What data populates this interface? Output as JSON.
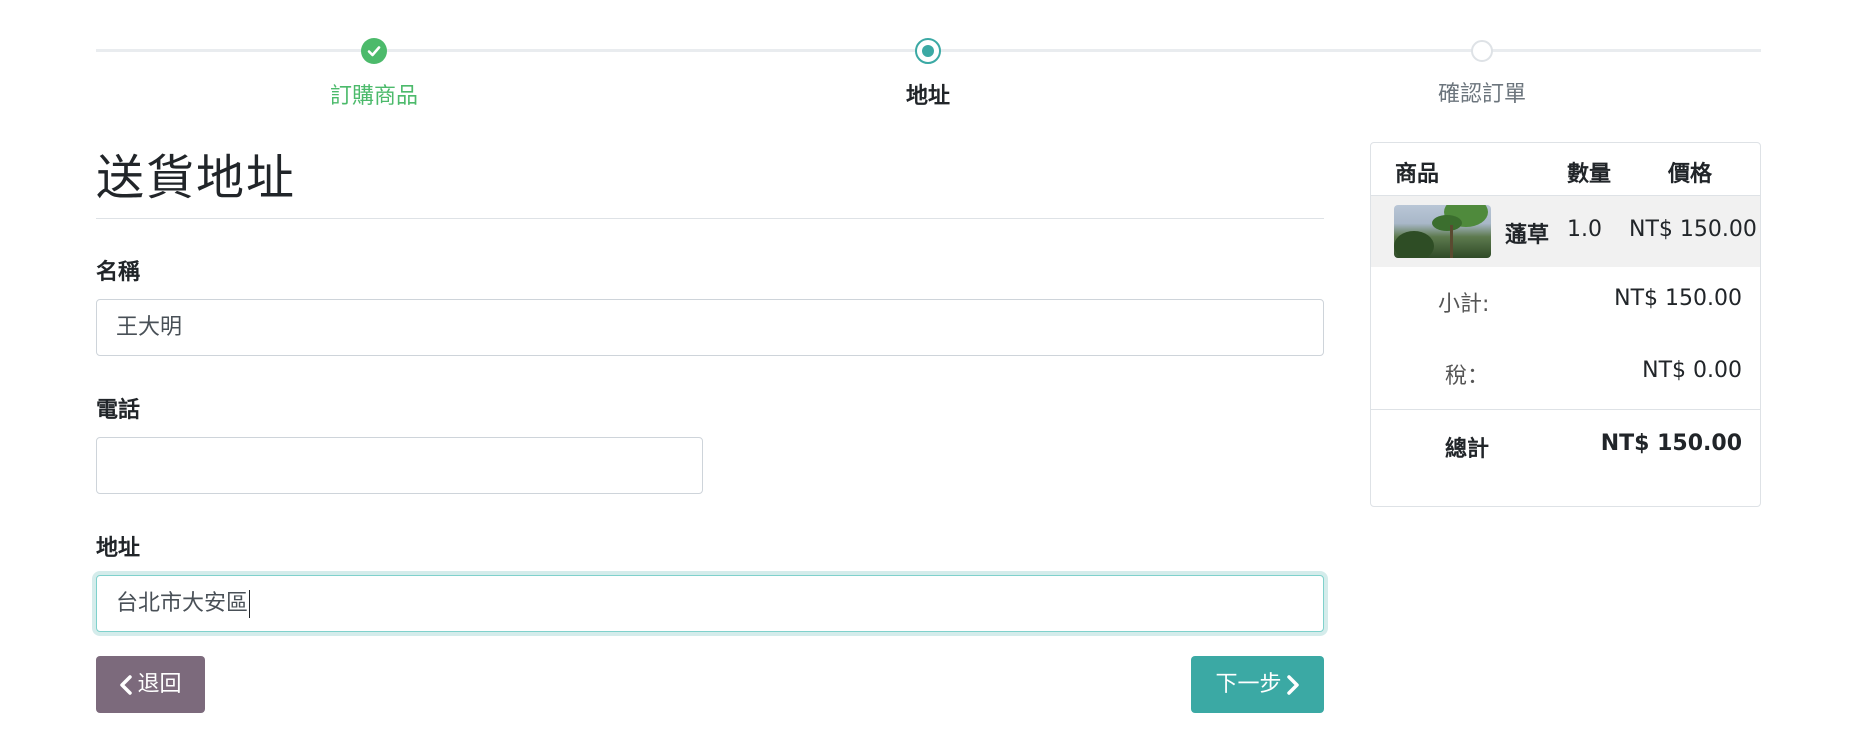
{
  "wizard": {
    "steps": [
      {
        "label": "訂購商品",
        "state": "done"
      },
      {
        "label": "地址",
        "state": "active"
      },
      {
        "label": "確認訂單",
        "state": "todo"
      }
    ]
  },
  "form": {
    "title": "送貨地址",
    "name_label": "名稱",
    "name_value": "王大明",
    "phone_label": "電話",
    "phone_value": "",
    "address_label": "地址",
    "address_value": "台北市大安區",
    "back_label": "退回",
    "next_label": "下一步"
  },
  "summary": {
    "headers": {
      "product": "商品",
      "quantity": "數量",
      "price": "價格"
    },
    "item": {
      "name": "蓪草",
      "quantity": "1.0",
      "price": "NT$ 150.00",
      "image_icon": "plant-photo"
    },
    "subtotal_label": "小計:",
    "subtotal_value": "NT$ 150.00",
    "tax_label": "稅：",
    "tax_value": "NT$ 0.00",
    "total_label": "總計",
    "total_value": "NT$ 150.00"
  },
  "colors": {
    "done_green": "#4cba6b",
    "active_teal": "#3ba9a4",
    "back_button": "#7c6a7c",
    "next_button": "#3ba9a4"
  }
}
